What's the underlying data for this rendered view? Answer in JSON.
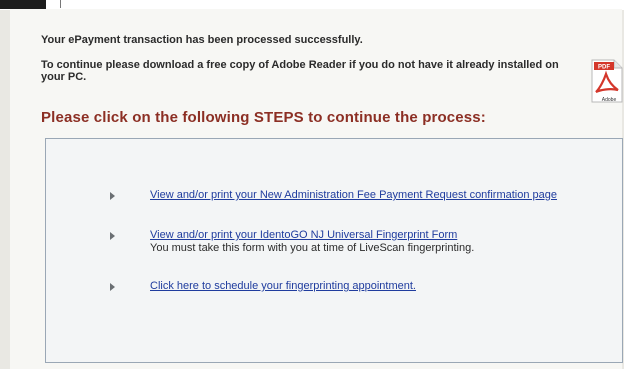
{
  "messages": {
    "success": "Your ePayment transaction has been processed successfully.",
    "download_prompt": "To continue please download a free copy of Adobe Reader if you do not have it already installed on your PC."
  },
  "pdf_icon": {
    "label_top": "PDF",
    "label_bottom": "Adobe",
    "icon": "adobe-pdf-icon"
  },
  "steps_heading": "Please click on the following STEPS to continue the process:",
  "steps": [
    {
      "link": "View and/or print your New Administration Fee Payment Request confirmation page",
      "note": ""
    },
    {
      "link": "View and/or print your IdentoGO NJ Universal Fingerprint Form",
      "note": "You must take this form with you at time of LiveScan fingerprinting."
    },
    {
      "link": "Click here to schedule your fingerprinting appointment.",
      "note": ""
    }
  ],
  "colors": {
    "heading": "#8c2f24",
    "link": "#1f3c9e",
    "pdf_red": "#d4372b"
  }
}
